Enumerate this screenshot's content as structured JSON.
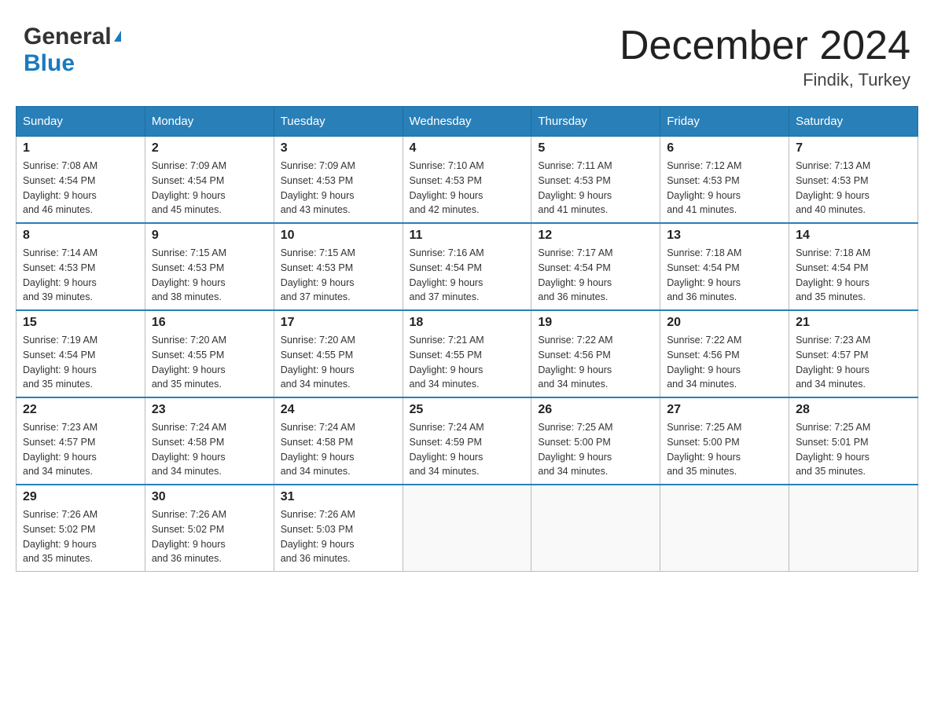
{
  "header": {
    "logo_general": "General",
    "logo_blue": "Blue",
    "month_title": "December 2024",
    "location": "Findik, Turkey"
  },
  "days_of_week": [
    "Sunday",
    "Monday",
    "Tuesday",
    "Wednesday",
    "Thursday",
    "Friday",
    "Saturday"
  ],
  "weeks": [
    [
      {
        "day": "1",
        "sunrise": "7:08 AM",
        "sunset": "4:54 PM",
        "daylight": "9 hours and 46 minutes."
      },
      {
        "day": "2",
        "sunrise": "7:09 AM",
        "sunset": "4:54 PM",
        "daylight": "9 hours and 45 minutes."
      },
      {
        "day": "3",
        "sunrise": "7:09 AM",
        "sunset": "4:53 PM",
        "daylight": "9 hours and 43 minutes."
      },
      {
        "day": "4",
        "sunrise": "7:10 AM",
        "sunset": "4:53 PM",
        "daylight": "9 hours and 42 minutes."
      },
      {
        "day": "5",
        "sunrise": "7:11 AM",
        "sunset": "4:53 PM",
        "daylight": "9 hours and 41 minutes."
      },
      {
        "day": "6",
        "sunrise": "7:12 AM",
        "sunset": "4:53 PM",
        "daylight": "9 hours and 41 minutes."
      },
      {
        "day": "7",
        "sunrise": "7:13 AM",
        "sunset": "4:53 PM",
        "daylight": "9 hours and 40 minutes."
      }
    ],
    [
      {
        "day": "8",
        "sunrise": "7:14 AM",
        "sunset": "4:53 PM",
        "daylight": "9 hours and 39 minutes."
      },
      {
        "day": "9",
        "sunrise": "7:15 AM",
        "sunset": "4:53 PM",
        "daylight": "9 hours and 38 minutes."
      },
      {
        "day": "10",
        "sunrise": "7:15 AM",
        "sunset": "4:53 PM",
        "daylight": "9 hours and 37 minutes."
      },
      {
        "day": "11",
        "sunrise": "7:16 AM",
        "sunset": "4:54 PM",
        "daylight": "9 hours and 37 minutes."
      },
      {
        "day": "12",
        "sunrise": "7:17 AM",
        "sunset": "4:54 PM",
        "daylight": "9 hours and 36 minutes."
      },
      {
        "day": "13",
        "sunrise": "7:18 AM",
        "sunset": "4:54 PM",
        "daylight": "9 hours and 36 minutes."
      },
      {
        "day": "14",
        "sunrise": "7:18 AM",
        "sunset": "4:54 PM",
        "daylight": "9 hours and 35 minutes."
      }
    ],
    [
      {
        "day": "15",
        "sunrise": "7:19 AM",
        "sunset": "4:54 PM",
        "daylight": "9 hours and 35 minutes."
      },
      {
        "day": "16",
        "sunrise": "7:20 AM",
        "sunset": "4:55 PM",
        "daylight": "9 hours and 35 minutes."
      },
      {
        "day": "17",
        "sunrise": "7:20 AM",
        "sunset": "4:55 PM",
        "daylight": "9 hours and 34 minutes."
      },
      {
        "day": "18",
        "sunrise": "7:21 AM",
        "sunset": "4:55 PM",
        "daylight": "9 hours and 34 minutes."
      },
      {
        "day": "19",
        "sunrise": "7:22 AM",
        "sunset": "4:56 PM",
        "daylight": "9 hours and 34 minutes."
      },
      {
        "day": "20",
        "sunrise": "7:22 AM",
        "sunset": "4:56 PM",
        "daylight": "9 hours and 34 minutes."
      },
      {
        "day": "21",
        "sunrise": "7:23 AM",
        "sunset": "4:57 PM",
        "daylight": "9 hours and 34 minutes."
      }
    ],
    [
      {
        "day": "22",
        "sunrise": "7:23 AM",
        "sunset": "4:57 PM",
        "daylight": "9 hours and 34 minutes."
      },
      {
        "day": "23",
        "sunrise": "7:24 AM",
        "sunset": "4:58 PM",
        "daylight": "9 hours and 34 minutes."
      },
      {
        "day": "24",
        "sunrise": "7:24 AM",
        "sunset": "4:58 PM",
        "daylight": "9 hours and 34 minutes."
      },
      {
        "day": "25",
        "sunrise": "7:24 AM",
        "sunset": "4:59 PM",
        "daylight": "9 hours and 34 minutes."
      },
      {
        "day": "26",
        "sunrise": "7:25 AM",
        "sunset": "5:00 PM",
        "daylight": "9 hours and 34 minutes."
      },
      {
        "day": "27",
        "sunrise": "7:25 AM",
        "sunset": "5:00 PM",
        "daylight": "9 hours and 35 minutes."
      },
      {
        "day": "28",
        "sunrise": "7:25 AM",
        "sunset": "5:01 PM",
        "daylight": "9 hours and 35 minutes."
      }
    ],
    [
      {
        "day": "29",
        "sunrise": "7:26 AM",
        "sunset": "5:02 PM",
        "daylight": "9 hours and 35 minutes."
      },
      {
        "day": "30",
        "sunrise": "7:26 AM",
        "sunset": "5:02 PM",
        "daylight": "9 hours and 36 minutes."
      },
      {
        "day": "31",
        "sunrise": "7:26 AM",
        "sunset": "5:03 PM",
        "daylight": "9 hours and 36 minutes."
      },
      null,
      null,
      null,
      null
    ]
  ],
  "labels": {
    "sunrise_prefix": "Sunrise: ",
    "sunset_prefix": "Sunset: ",
    "daylight_prefix": "Daylight: "
  }
}
